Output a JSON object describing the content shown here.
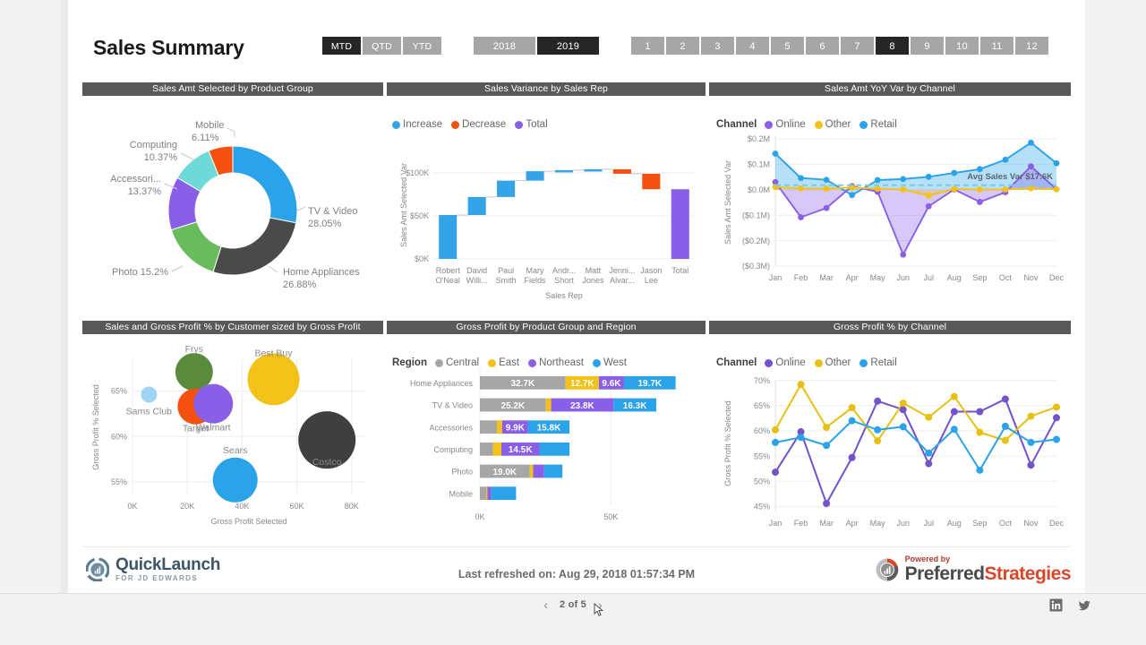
{
  "header": {
    "title": "Sales Summary",
    "period_buttons": [
      {
        "label": "MTD",
        "selected": true
      },
      {
        "label": "QTD",
        "selected": false
      },
      {
        "label": "YTD",
        "selected": false
      }
    ],
    "year_buttons": [
      {
        "label": "2018",
        "selected": false
      },
      {
        "label": "2019",
        "selected": true
      }
    ],
    "month_buttons": [
      {
        "label": "1",
        "selected": false
      },
      {
        "label": "2",
        "selected": false
      },
      {
        "label": "3",
        "selected": false
      },
      {
        "label": "4",
        "selected": false
      },
      {
        "label": "5",
        "selected": false
      },
      {
        "label": "6",
        "selected": false
      },
      {
        "label": "7",
        "selected": false
      },
      {
        "label": "8",
        "selected": true
      },
      {
        "label": "9",
        "selected": false
      },
      {
        "label": "10",
        "selected": false
      },
      {
        "label": "11",
        "selected": false
      },
      {
        "label": "12",
        "selected": false
      }
    ]
  },
  "footer": {
    "quicklaunch_name": "QuickLaunch",
    "quicklaunch_sub": "FOR JD EDWARDS",
    "refreshed_text": "Last refreshed on: Aug 29, 2018 01:57:34 PM",
    "powered_by": "Powered by",
    "ps_name_a": "Preferred",
    "ps_name_b": "Strategies"
  },
  "pagenav": {
    "prev_label": "‹",
    "next_label": "›",
    "page_label": "2 of 5",
    "linkedin_label": "in",
    "twitter_label": "twitter"
  },
  "chart_data": [
    {
      "id": "donut",
      "type": "pie",
      "title": "Sales Amt Selected by Product Group",
      "slices": [
        {
          "label": "TV & Video",
          "value": 28.05,
          "display": "28.05%",
          "color": "#2aa3e8"
        },
        {
          "label": "Home Appliances",
          "value": 26.88,
          "display": "26.88%",
          "color": "#4a4a4a"
        },
        {
          "label": "Photo",
          "value": 15.2,
          "display": "15.2%",
          "color": "#6aba5e"
        },
        {
          "label": "Accessori...",
          "value": 13.37,
          "display": "13.37%",
          "color": "#8a5fe8"
        },
        {
          "label": "Computing",
          "value": 10.37,
          "display": "10.37%",
          "color": "#6ed9d9"
        },
        {
          "label": "Mobile",
          "value": 6.11,
          "display": "6.11%",
          "color": "#f5500f"
        }
      ]
    },
    {
      "id": "waterfall",
      "type": "bar",
      "title": "Sales Variance by Sales Rep",
      "xlabel": "Sales Rep",
      "ylabel": "Sales Amt Selected Var",
      "ylim": [
        0,
        125000
      ],
      "yticks": [
        "$0K",
        "$50K",
        "$100K"
      ],
      "legend": [
        {
          "label": "Increase",
          "color": "#35a3e8"
        },
        {
          "label": "Decrease",
          "color": "#f4500f"
        },
        {
          "label": "Total",
          "color": "#8a5fe8"
        }
      ],
      "categories": [
        "Robert\nO'Neal",
        "David\nWilli...",
        "Paul\nSmith",
        "Mary\nFields",
        "Andr...\nShort",
        "Matt\nJones",
        "Jenni...\nAlvar...",
        "Jason\nLee",
        "Total"
      ],
      "bars": [
        {
          "label": "Robert O'Neal",
          "start": 0,
          "end": 51000,
          "kind": "increase"
        },
        {
          "label": "David Williams",
          "start": 51000,
          "end": 72000,
          "kind": "increase"
        },
        {
          "label": "Paul Smith",
          "start": 72000,
          "end": 91000,
          "kind": "increase"
        },
        {
          "label": "Mary Fields",
          "start": 91000,
          "end": 102000,
          "kind": "increase"
        },
        {
          "label": "Andrew Short",
          "start": 102000,
          "end": 103200,
          "kind": "increase"
        },
        {
          "label": "Matt Jones",
          "start": 103200,
          "end": 104200,
          "kind": "increase"
        },
        {
          "label": "Jennifer Alvarez",
          "start": 104200,
          "end": 99000,
          "kind": "decrease"
        },
        {
          "label": "Jason Lee",
          "start": 99000,
          "end": 81000,
          "kind": "decrease"
        },
        {
          "label": "Total",
          "start": 0,
          "end": 81000,
          "kind": "total"
        }
      ]
    },
    {
      "id": "yoy",
      "type": "area",
      "title": "Sales Amt YoY Var by Channel",
      "legend_title": "Channel",
      "ylabel": "Sales Amt Selected Var",
      "ylim": [
        -300000,
        200000
      ],
      "yticks": [
        "$0.2M",
        "$0.1M",
        "$0.0M",
        "($0.1M)",
        "($0.2M)",
        "($0.3M)"
      ],
      "x": [
        "Jan",
        "Feb",
        "Mar",
        "Apr",
        "May",
        "Jun",
        "Jul",
        "Aug",
        "Sep",
        "Oct",
        "Nov",
        "Dec"
      ],
      "series": [
        {
          "name": "Online",
          "color": "#8a5fe8",
          "values": [
            30000,
            -108000,
            -72000,
            14000,
            -8000,
            -255000,
            -65000,
            1000,
            -48000,
            -10000,
            92000,
            2000
          ]
        },
        {
          "name": "Other",
          "color": "#f2c218",
          "values": [
            11000,
            5000,
            4000,
            9000,
            4000,
            1000,
            -23000,
            3000,
            1000,
            1000,
            6000,
            2000
          ]
        },
        {
          "name": "Retail",
          "color": "#2aa3e8",
          "values": [
            142000,
            46000,
            39000,
            -21000,
            38000,
            42000,
            51000,
            66000,
            81000,
            118000,
            185000,
            104000
          ]
        }
      ],
      "annotation": {
        "text": "Avg Sales Var $17.6K",
        "value": 17600,
        "color": "#7ec9e8"
      }
    },
    {
      "id": "scatter",
      "type": "scatter",
      "title": "Sales and Gross Profit % by Customer sized by Gross Profit",
      "xlabel": "Gross Profit Selected",
      "ylabel": "Gross Profit % Selected",
      "xlim": [
        0,
        85000
      ],
      "ylim": [
        53.5,
        68.5
      ],
      "xticks": [
        "0K",
        "20K",
        "40K",
        "60K",
        "80K"
      ],
      "yticks": [
        "55%",
        "60%",
        "65%"
      ],
      "points": [
        {
          "label": "Sams Club",
          "x": 6000,
          "y": 64.6,
          "size": 9,
          "color": "#9ed5f5"
        },
        {
          "label": "Frys",
          "x": 22500,
          "y": 67.1,
          "size": 21,
          "color": "#5a8a3c"
        },
        {
          "label": "Target",
          "x": 23000,
          "y": 63.3,
          "size": 20,
          "color": "#f4500f"
        },
        {
          "label": "Walmart",
          "x": 29500,
          "y": 63.6,
          "size": 22,
          "color": "#8a5fe8"
        },
        {
          "label": "Best Buy",
          "x": 51500,
          "y": 66.3,
          "size": 29,
          "color": "#f2c218"
        },
        {
          "label": "Sears",
          "x": 37500,
          "y": 55.2,
          "size": 25,
          "color": "#2aa3e8"
        },
        {
          "label": "Costco",
          "x": 71000,
          "y": 59.6,
          "size": 32,
          "color": "#3f3f3f"
        }
      ]
    },
    {
      "id": "stacked",
      "type": "bar",
      "title": "Gross Profit by Product Group and Region",
      "legend_title": "Region",
      "xticks": [
        "0K",
        "50K"
      ],
      "xlim": [
        0,
        82000
      ],
      "series": [
        {
          "name": "Central",
          "color": "#a6a6a6"
        },
        {
          "name": "East",
          "color": "#f2c218"
        },
        {
          "name": "Northeast",
          "color": "#8a5fe8"
        },
        {
          "name": "West",
          "color": "#2aa3e8"
        }
      ],
      "rows": [
        {
          "category": "Home Appliances",
          "values": [
            32700,
            12700,
            9600,
            19700
          ],
          "labels": [
            "32.7K",
            "12.7K",
            "9.6K",
            "19.7K"
          ]
        },
        {
          "category": "TV & Video",
          "values": [
            25200,
            2000,
            23800,
            16300
          ],
          "labels": [
            "25.2K",
            "",
            "23.8K",
            "16.3K"
          ]
        },
        {
          "category": "Accessories",
          "values": [
            6500,
            2000,
            9900,
            15800
          ],
          "labels": [
            "",
            "",
            "9.9K",
            "15.8K"
          ]
        },
        {
          "category": "Computing",
          "values": [
            5000,
            3200,
            14500,
            11500
          ],
          "labels": [
            "",
            "",
            "14.5K",
            ""
          ]
        },
        {
          "category": "Photo",
          "values": [
            19000,
            1300,
            4200,
            7000
          ],
          "labels": [
            "19.0K",
            "",
            "",
            ""
          ]
        },
        {
          "category": "Mobile",
          "values": [
            2500,
            400,
            1400,
            9500
          ],
          "labels": [
            "",
            "",
            "",
            ""
          ]
        }
      ]
    },
    {
      "id": "gp",
      "type": "line",
      "title": "Gross Profit % by Channel",
      "legend_title": "Channel",
      "ylabel": "Gross Profit % Selected",
      "ylim": [
        44,
        71
      ],
      "yticks": [
        "70%",
        "65%",
        "60%",
        "55%",
        "50%",
        "45%"
      ],
      "x": [
        "Jan",
        "Feb",
        "Mar",
        "Apr",
        "May",
        "Jun",
        "Jul",
        "Aug",
        "Sep",
        "Oct",
        "Nov",
        "Dec"
      ],
      "series": [
        {
          "name": "Online",
          "color": "#7253c9",
          "values": [
            51.8,
            59.8,
            45.6,
            54.7,
            65.9,
            64.2,
            53.5,
            63.8,
            63.8,
            66.3,
            53.2,
            62.6
          ]
        },
        {
          "name": "Other",
          "color": "#e8c013",
          "values": [
            60.2,
            69.2,
            60.7,
            64.6,
            58.0,
            65.5,
            62.7,
            66.8,
            59.7,
            58.1,
            62.9,
            64.7
          ]
        },
        {
          "name": "Retail",
          "color": "#2aa3e8",
          "values": [
            57.7,
            58.7,
            57.1,
            62.0,
            60.2,
            60.8,
            55.6,
            60.3,
            52.2,
            60.9,
            57.7,
            58.3
          ]
        }
      ]
    }
  ]
}
